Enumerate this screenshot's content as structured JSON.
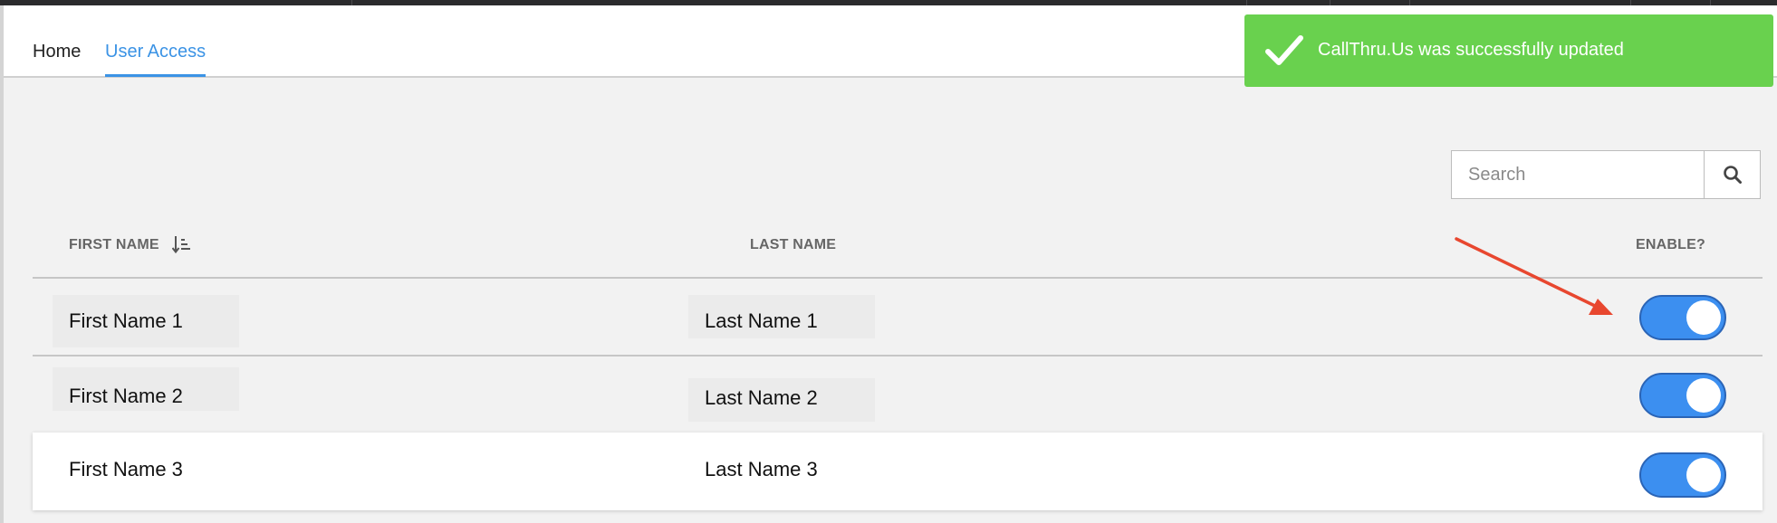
{
  "nav": {
    "home": "Home",
    "user_access": "User Access",
    "active": "user_access",
    "accent": "#3b93e5"
  },
  "toast": {
    "message": "CallThru.Us was successfully updated",
    "icon": "check-icon",
    "color": "#69d14e"
  },
  "search": {
    "placeholder": "Search",
    "value": "",
    "icon": "search-icon"
  },
  "table": {
    "columns": {
      "first_name": "FIRST NAME",
      "last_name": "LAST NAME",
      "enable": "ENABLE?"
    },
    "sort": {
      "column": "first_name",
      "icon": "sort-icon"
    },
    "rows": [
      {
        "first_name": "First Name 1",
        "last_name": "Last Name 1",
        "enabled": true
      },
      {
        "first_name": "First Name 2",
        "last_name": "Last Name 2",
        "enabled": true
      },
      {
        "first_name": "First Name 3",
        "last_name": "Last Name 3",
        "enabled": true
      }
    ],
    "toggle_color": "#3c8ff0"
  },
  "annotation": {
    "type": "arrow",
    "color": "#e8472f",
    "points_to": "row-1-enable-toggle"
  }
}
